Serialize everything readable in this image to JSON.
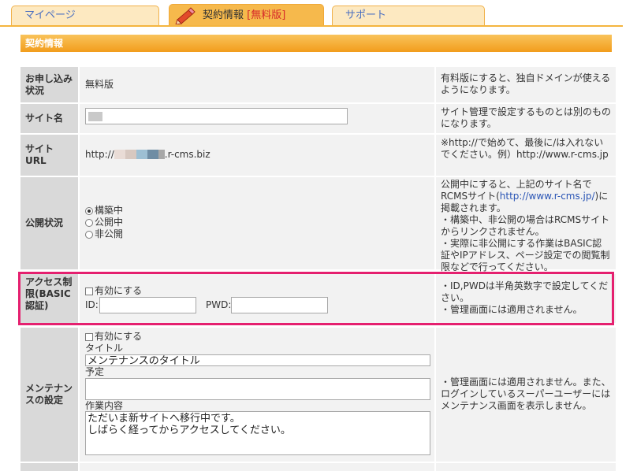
{
  "tabs": [
    {
      "label": "マイページ",
      "active": false
    },
    {
      "label": "契約情報",
      "free_suffix": "[無料版]",
      "active": true,
      "icon": "pencil-icon"
    },
    {
      "label": "サポート",
      "active": false
    }
  ],
  "section": {
    "title": "契約情報"
  },
  "rows": {
    "status": {
      "label": "お申し込み状況",
      "value": "無料版",
      "help": "有料版にすると、独自ドメインが使えるようになります。"
    },
    "site_name": {
      "label": "サイト名",
      "value": "",
      "help": "サイト管理で設定するものとは別のものになります。"
    },
    "site_url": {
      "label": "サイトURL",
      "prefix": "http://",
      "suffix": ".r-cms.biz",
      "help": "※http://で始めて、最後に/は入れないでください。例）http://www.r-cms.jp"
    },
    "publish": {
      "label": "公開状況",
      "options": [
        "構築中",
        "公開中",
        "非公開"
      ],
      "selected": "構築中",
      "help_pre": "公開中にすると、上記のサイト名でRCMSサイト(",
      "help_link": "http://www.r-cms.jp/",
      "help_post": ")に掲載されます。",
      "help_note1": "・構築中、非公開の場合はRCMSサイトからリンクされません。",
      "help_note2": "・実際に非公開にする作業はBASIC認証やIPアドレス、ページ設定での閲覧制限などで行ってください。"
    },
    "access": {
      "label": "アクセス制限(BASIC認証)",
      "enable_label": "有効にする",
      "id_label": "ID:",
      "id_value": "",
      "pwd_label": "PWD:",
      "pwd_value": "",
      "help1": "・ID,PWDは半角英数字で設定してください。",
      "help2": "・管理画面には適用されません。"
    },
    "maintenance": {
      "label": "メンテナンスの設定",
      "enable_label": "有効にする",
      "title_label": "タイトル",
      "title_value": "メンテナンスのタイトル",
      "schedule_label": "予定",
      "schedule_value": "",
      "content_label": "作業内容",
      "content_value": "ただいま新サイトへ移行中です。\nしばらく経ってからアクセスしてください。",
      "help": "・管理画面には適用されません。また、ログインしているスーパーユーザーにはメンテナンス画面を表示しません。"
    }
  },
  "colors": {
    "tab_active": "#f6b94c",
    "tab_inactive": "#fde9c1",
    "highlight": "#e5206f",
    "link": "#2a55b5",
    "free_red": "#d6292a"
  }
}
